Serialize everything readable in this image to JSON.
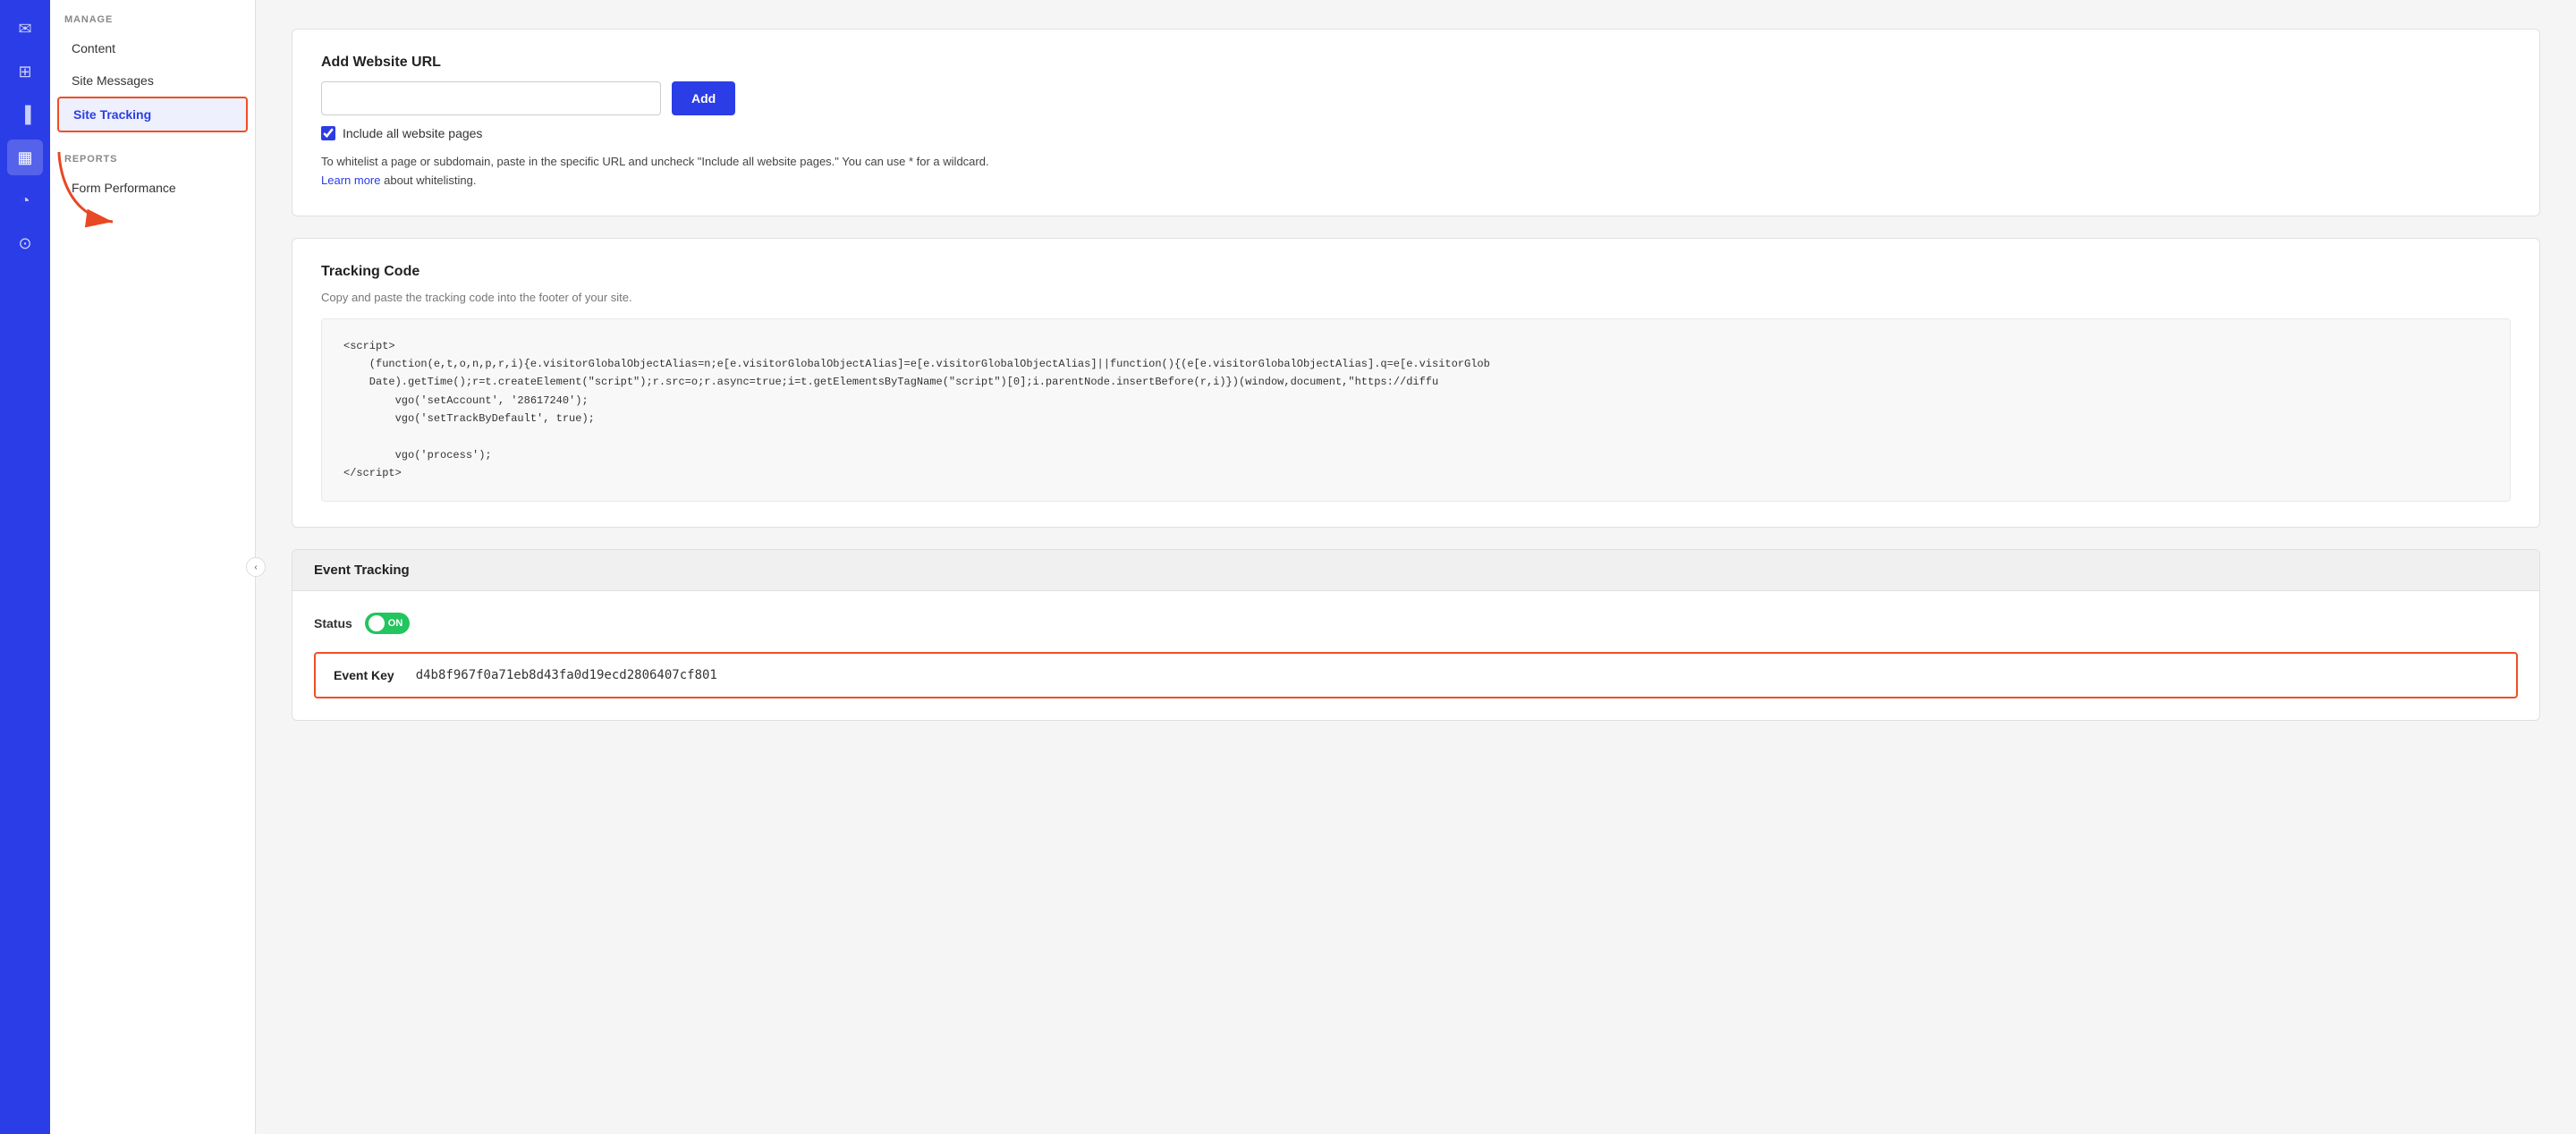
{
  "iconBar": {
    "icons": [
      {
        "name": "email-icon",
        "symbol": "✉",
        "active": false
      },
      {
        "name": "network-icon",
        "symbol": "⊞",
        "active": false
      },
      {
        "name": "chart-bar-icon",
        "symbol": "▐",
        "active": false
      },
      {
        "name": "grid-icon",
        "symbol": "▦",
        "active": true
      },
      {
        "name": "pie-chart-icon",
        "symbol": "◔",
        "active": false
      },
      {
        "name": "upload-icon",
        "symbol": "⊙",
        "active": false
      }
    ]
  },
  "sidebar": {
    "manageLabel": "MANAGE",
    "reportsLabel": "REPORTS",
    "items": [
      {
        "label": "Content",
        "active": false,
        "id": "content"
      },
      {
        "label": "Site Messages",
        "active": false,
        "id": "site-messages"
      },
      {
        "label": "Site Tracking",
        "active": true,
        "id": "site-tracking"
      }
    ],
    "reportItems": [
      {
        "label": "Form Performance",
        "active": false,
        "id": "form-performance"
      }
    ]
  },
  "addWebsiteURL": {
    "title": "Add Website URL",
    "inputPlaceholder": "",
    "addButtonLabel": "Add",
    "checkboxLabel": "Include all website pages",
    "infoText": "To whitelist a page or subdomain, paste in the specific URL and uncheck \"Include all website pages.\" You can use * for a wildcard.",
    "learnMoreText": "Learn more",
    "whitelistText": "about whitelisting."
  },
  "trackingCode": {
    "title": "Tracking Code",
    "subtitle": "Copy and paste the tracking code into the footer of your site.",
    "code": "<script>\n    (function(e,t,o,n,p,r,i){e.visitorGlobalObjectAlias=n;e[e.visitorGlobalObjectAlias]=e[e.visitorGlobalObjectAlias]||function(){(e[e.visitorGlobalObjectAlias].q=e[e.visitorGlob\n    Date).getTime();r=t.createElement(\"script\");r.src=o;r.async=true;i=t.getElementsByTagName(\"script\")[0];i.parentNode.insertBefore(r,i)})(window,document,\"https://diffu\n        vgo('setAccount', '28617240');\n        vgo('setTrackByDefault', true);\n\n        vgo('process');\n<\\/script>"
  },
  "eventTracking": {
    "headerLabel": "Event Tracking",
    "statusLabel": "Status",
    "toggleLabel": "ON",
    "toggleOn": true,
    "eventKeyLabel": "Event Key",
    "eventKeyValue": "d4b8f967f0a71eb8d43fa0d19ecd2806407cf801"
  }
}
